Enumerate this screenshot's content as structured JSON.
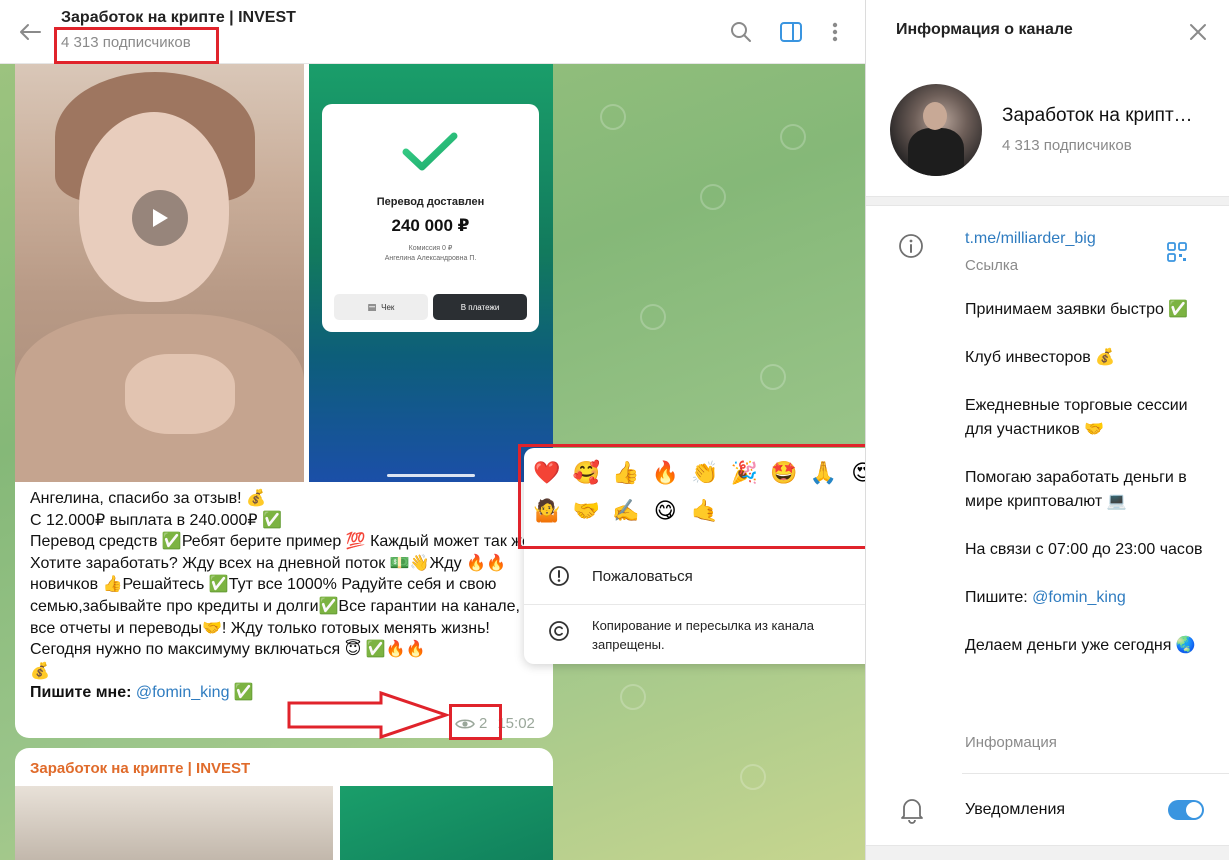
{
  "header": {
    "title": "Заработок на крипте | INVEST",
    "subtitle": "4 313 подписчиков"
  },
  "message": {
    "receipt": {
      "title": "Перевод доставлен",
      "amount": "240 000 ₽",
      "fee": "Комиссия 0 ₽",
      "name": "Ангелина Александровна П.",
      "btn_check": "Чек",
      "btn_pay": "В платежи"
    },
    "text": "Ангелина, спасибо за отзыв! 💰\nС 12.000₽ выплата в 240.000₽ ✅\nПеревод средств ✅Ребят берите пример 💯 Каждый может так же\nХотите заработать? Жду всех на дневной поток 💵👋Жду 🔥🔥новичков 👍Решайтесь ✅Тут все 1000% Радуйте себя и свою семью,забывайте про кредиты и долги✅Все гарантии на канале, все отчеты и переводы🤝! Жду только готовых менять жизнь!  Сегодня нужно по максимуму включаться 😇 ✅🔥🔥\n💰",
    "write_label": "Пишите мне: ",
    "write_link": "@fomin_king",
    "write_tail": " ✅",
    "views": "2",
    "time": "15:02"
  },
  "message2": {
    "author": "Заработок на крипте | INVEST"
  },
  "popup": {
    "emojis": [
      "❤️",
      "🥰",
      "👍",
      "🔥",
      "👏",
      "🎉",
      "🤩",
      "🙏",
      "😍",
      "💯",
      "🤷",
      "🤝",
      "✍️",
      "😋",
      "🤙"
    ],
    "report_label": "Пожаловаться",
    "copy_notice": "Копирование и пересылка из канала запрещены."
  },
  "info": {
    "panel_title": "Информация о канале",
    "channel_name": "Заработок на крипте | INVEST",
    "subscribers": "4 313 подписчиков",
    "link": "t.me/milliarder_big",
    "link_caption": "Ссылка",
    "description": [
      "Принимаем заявки быстро ✅",
      "Клуб инвесторов 💰",
      "Ежедневные торговые сессии для участников 🤝",
      "Помогаю заработать деньги в мире криптовалют 💻",
      "На связи с 07:00 до 23:00 часов"
    ],
    "write_label": "Пишите: ",
    "write_link": "@fomin_king",
    "last_line": "Делаем деньги уже сегодня 🌏",
    "desc_caption": "Информация",
    "notifications_label": "Уведомления",
    "notifications_on": true
  },
  "colors": {
    "accent": "#3a95e0",
    "link": "#2f7cc0",
    "highlight": "#e0232b",
    "author": "#e06b2b"
  }
}
